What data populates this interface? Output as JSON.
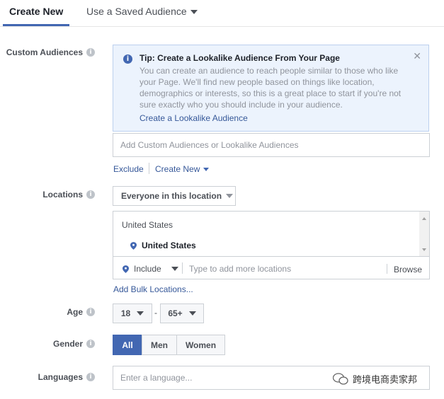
{
  "tabs": [
    {
      "label": "Create New",
      "active": true
    },
    {
      "label": "Use a Saved Audience",
      "active": false
    }
  ],
  "custom_audiences": {
    "label": "Custom Audiences",
    "tip_title": "Tip: Create a Lookalike Audience From Your Page",
    "tip_body": "You can create an audience to reach people similar to those who like your Page. We'll find new people based on things like location, demographics or interests, so this is a great place to start if you're not sure exactly who you should include in your audience.",
    "tip_link": "Create a Lookalike Audience",
    "input_placeholder": "Add Custom Audiences or Lookalike Audiences",
    "exclude_label": "Exclude",
    "create_new_label": "Create New"
  },
  "locations": {
    "label": "Locations",
    "dropdown_value": "Everyone in this location",
    "group_header": "United States",
    "selected_location": "United States",
    "include_label": "Include",
    "search_placeholder": "Type to add more locations",
    "browse_label": "Browse",
    "bulk_link": "Add Bulk Locations..."
  },
  "age": {
    "label": "Age",
    "min": "18",
    "separator": "-",
    "max": "65+"
  },
  "gender": {
    "label": "Gender",
    "options": [
      "All",
      "Men",
      "Women"
    ],
    "selected": "All"
  },
  "languages": {
    "label": "Languages",
    "placeholder": "Enter a language..."
  },
  "watermark": {
    "text": "跨境电商卖家邦"
  },
  "colors": {
    "accent": "#4267b2",
    "link": "#365899",
    "tip_background": "#ecf3fd"
  }
}
